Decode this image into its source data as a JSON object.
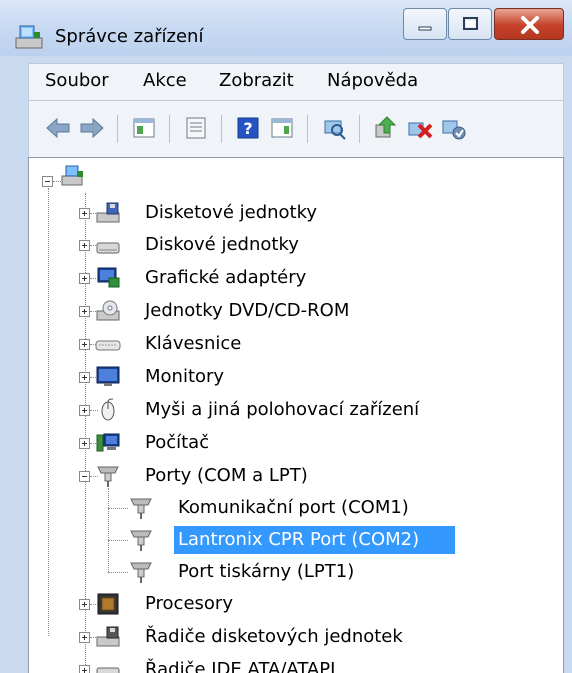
{
  "window": {
    "title": "Správce zařízení"
  },
  "menu": [
    "Soubor",
    "Akce",
    "Zobrazit",
    "Nápověda"
  ],
  "toolbar_icons": [
    "back-arrow-icon",
    "forward-arrow-icon",
    "properties-pane-icon",
    "properties-icon",
    "help-icon",
    "action-pane-icon",
    "scan-hardware-icon",
    "update-driver-icon",
    "uninstall-icon",
    "enable-device-icon"
  ],
  "tree": {
    "items": [
      "Disketové jednotky",
      "Diskové jednotky",
      "Grafické adaptéry",
      "Jednotky DVD/CD-ROM",
      "Klávesnice",
      "Monitory",
      "Myši a jiná polohovací zařízení",
      "Počítač",
      "Porty (COM a LPT)",
      "Komunikační port (COM1)",
      "Lantronix CPR Port (COM2)",
      "Port tiskárny (LPT1)",
      "Procesory",
      "Řadiče disketových jednotek",
      "Řadiče IDE ATA/ATAPI"
    ]
  },
  "colors": {
    "selection": "#3399ff",
    "title_bg": "#c7d9f2"
  }
}
